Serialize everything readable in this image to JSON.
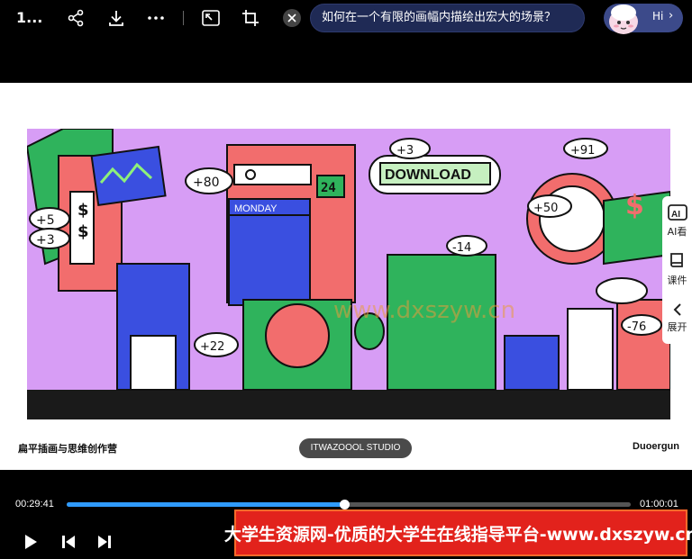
{
  "top_bar": {
    "title": "1...",
    "ask_text": "如何在一个有限的画幅内描绘出宏大的场景？",
    "hi_label": "Hi",
    "hi_chevron": "›"
  },
  "icons": {
    "share": "share-icon",
    "download": "download-icon",
    "more": "more-icon",
    "pip": "picture-in-picture-icon",
    "crop": "crop-icon",
    "close": "close-icon"
  },
  "artwork": {
    "labels": {
      "download_sign": "DOWNLOAD",
      "monday": "MONDAY",
      "day_number": "24",
      "plus80": "+80",
      "plus5": "+5",
      "plus3": "+3",
      "plus22": "+22",
      "plus50": "+50",
      "plus91": "+91",
      "plus3b": "+3",
      "minus14": "-14",
      "minus76": "-76",
      "currency": "$",
      "watermark": "www.dxszyw.cn"
    }
  },
  "captions": {
    "left": "扁平插画与思维创作营",
    "middle": "ITWAZOOOL STUDIO",
    "right": "Duoergun"
  },
  "side_panel": {
    "ai_label": "AI看",
    "courseware_label": "课件",
    "expand_label": "展开"
  },
  "player": {
    "elapsed": "00:29:41",
    "total": "01:00:01",
    "progress": 0.492,
    "accent_color": "#2f9bff"
  },
  "banner": {
    "text": "大学生资源网-优质的大学生在线指导平台-www.dxszyw.cn"
  }
}
